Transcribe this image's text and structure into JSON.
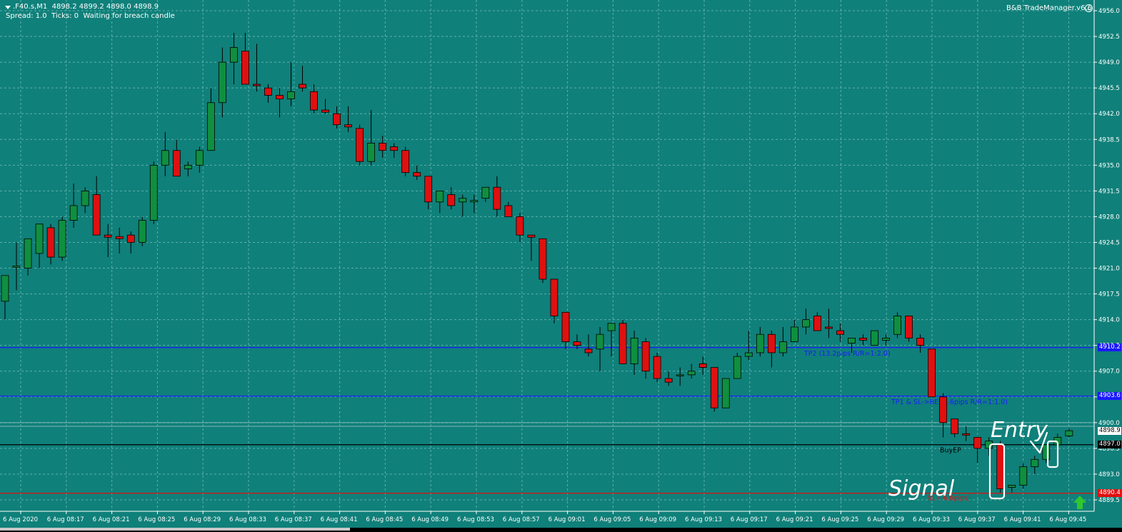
{
  "header": {
    "symbol": ".F40.s,M1",
    "ohlc": "4898.2 4899.2 4898.0 4898.9",
    "status": "Spread: 1.0  Ticks: 0  Waiting for breach candle"
  },
  "trade_manager": {
    "label": "B&B TradeManager.v6.6",
    "icon": "smiley-icon"
  },
  "price_axis": {
    "ticks": [
      "4956.0",
      "4952.5",
      "4949.0",
      "4945.5",
      "4942.0",
      "4938.5",
      "4935.0",
      "4931.5",
      "4928.0",
      "4924.5",
      "4921.0",
      "4917.5",
      "4914.0",
      "4910.5",
      "4907.0",
      "4903.5",
      "4900.0",
      "4896.5",
      "4893.0",
      "4889.5"
    ],
    "range": [
      4888.6,
      4956.0
    ]
  },
  "time_axis": {
    "labels": [
      "6 Aug 2020",
      "6 Aug 08:17",
      "6 Aug 08:21",
      "6 Aug 08:25",
      "6 Aug 08:29",
      "6 Aug 08:33",
      "6 Aug 08:37",
      "6 Aug 08:41",
      "6 Aug 08:45",
      "6 Aug 08:49",
      "6 Aug 08:53",
      "6 Aug 08:57",
      "6 Aug 09:01",
      "6 Aug 09:05",
      "6 Aug 09:09",
      "6 Aug 09:13",
      "6 Aug 09:17",
      "6 Aug 09:21",
      "6 Aug 09:25",
      "6 Aug 09:29",
      "6 Aug 09:33",
      "6 Aug 09:37",
      "6 Aug 09:41",
      "6 Aug 09:45"
    ]
  },
  "levels": [
    {
      "id": "tp2",
      "price": 4910.2,
      "tag": "4910.2",
      "label": "TP2 (13.2pips R/R=1:2.0)",
      "color": "#1a1aff"
    },
    {
      "id": "tp1",
      "price": 4903.6,
      "tag": "4903.6",
      "label": "TP1 & SL->BE (6.6pips R/R=1:1.0)",
      "color": "#1a1aff"
    },
    {
      "id": "buyep",
      "price": 4897.0,
      "tag": "4897.0",
      "label": "BuyEP",
      "color": "#000000"
    },
    {
      "id": "sl",
      "price": 4890.4,
      "tag": "4890.4",
      "label": "SL (-6.6pips)",
      "color": "#e01010"
    }
  ],
  "current_price": {
    "value": 4898.9,
    "tag": "4898.9"
  },
  "annotations": {
    "signal": "Signal",
    "entry": "Entry"
  },
  "colors": {
    "background": "#10807a",
    "bull": "#0f8f3f",
    "bear": "#e01010",
    "grid": "#5fb0ab"
  },
  "chart_data": {
    "type": "candlestick",
    "title": "",
    "xlabel": "",
    "ylabel": "",
    "ylim": [
      4888.6,
      4956.0
    ],
    "grid": true,
    "candles": [
      {
        "o": 4916.5,
        "h": 4919,
        "l": 4914,
        "c": 4920
      },
      {
        "o": 4921.1,
        "h": 4924.5,
        "l": 4918,
        "c": 4921.3
      },
      {
        "o": 4921,
        "h": 4924,
        "l": 4920,
        "c": 4925
      },
      {
        "o": 4923,
        "h": 4927,
        "l": 4921,
        "c": 4927
      },
      {
        "o": 4926.5,
        "h": 4927,
        "l": 4921.5,
        "c": 4922.5
      },
      {
        "o": 4922.5,
        "h": 4928,
        "l": 4922,
        "c": 4927.5
      },
      {
        "o": 4927.5,
        "h": 4932.5,
        "l": 4926.5,
        "c": 4929.5
      },
      {
        "o": 4929.5,
        "h": 4932,
        "l": 4928.5,
        "c": 4931.5
      },
      {
        "o": 4931,
        "h": 4933.5,
        "l": 4925.5,
        "c": 4925.5
      },
      {
        "o": 4925.5,
        "h": 4927,
        "l": 4922.5,
        "c": 4925.2
      },
      {
        "o": 4925.3,
        "h": 4926.5,
        "l": 4923,
        "c": 4925
      },
      {
        "o": 4925.5,
        "h": 4926,
        "l": 4923,
        "c": 4924.5
      },
      {
        "o": 4924.5,
        "h": 4928,
        "l": 4924,
        "c": 4927.5
      },
      {
        "o": 4927.5,
        "h": 4935.5,
        "l": 4927,
        "c": 4935
      },
      {
        "o": 4935,
        "h": 4939.5,
        "l": 4933.5,
        "c": 4937
      },
      {
        "o": 4937,
        "h": 4938.5,
        "l": 4933.5,
        "c": 4933.5
      },
      {
        "o": 4934.5,
        "h": 4935.5,
        "l": 4933.5,
        "c": 4935
      },
      {
        "o": 4935,
        "h": 4937.5,
        "l": 4934,
        "c": 4937
      },
      {
        "o": 4937,
        "h": 4945.5,
        "l": 4937,
        "c": 4943.5
      },
      {
        "o": 4943.5,
        "h": 4951,
        "l": 4941.5,
        "c": 4949
      },
      {
        "o": 4949,
        "h": 4953,
        "l": 4946,
        "c": 4951
      },
      {
        "o": 4950.5,
        "h": 4953,
        "l": 4946,
        "c": 4946
      },
      {
        "o": 4946,
        "h": 4951.5,
        "l": 4945,
        "c": 4945.8
      },
      {
        "o": 4945.5,
        "h": 4946,
        "l": 4943.5,
        "c": 4944.5
      },
      {
        "o": 4944.5,
        "h": 4945.5,
        "l": 4941.5,
        "c": 4944
      },
      {
        "o": 4944,
        "h": 4949,
        "l": 4943,
        "c": 4945
      },
      {
        "o": 4946,
        "h": 4948.5,
        "l": 4945,
        "c": 4945.5
      },
      {
        "o": 4945,
        "h": 4946,
        "l": 4942,
        "c": 4942.5
      },
      {
        "o": 4942.5,
        "h": 4944,
        "l": 4942,
        "c": 4942.2
      },
      {
        "o": 4942,
        "h": 4943,
        "l": 4940,
        "c": 4940.5
      },
      {
        "o": 4940.5,
        "h": 4943,
        "l": 4939.5,
        "c": 4940.2
      },
      {
        "o": 4940,
        "h": 4940.5,
        "l": 4935,
        "c": 4935.5
      },
      {
        "o": 4935.5,
        "h": 4942.5,
        "l": 4935,
        "c": 4938
      },
      {
        "o": 4938,
        "h": 4939,
        "l": 4936,
        "c": 4937
      },
      {
        "o": 4937.5,
        "h": 4938,
        "l": 4936,
        "c": 4937
      },
      {
        "o": 4937,
        "h": 4937.5,
        "l": 4933.5,
        "c": 4934
      },
      {
        "o": 4934,
        "h": 4935,
        "l": 4933,
        "c": 4933.5
      },
      {
        "o": 4933.5,
        "h": 4933.5,
        "l": 4929,
        "c": 4930
      },
      {
        "o": 4930,
        "h": 4931.5,
        "l": 4928.5,
        "c": 4931.5
      },
      {
        "o": 4931,
        "h": 4932,
        "l": 4929,
        "c": 4929.5
      },
      {
        "o": 4930,
        "h": 4931,
        "l": 4928,
        "c": 4930.5
      },
      {
        "o": 4930,
        "h": 4931,
        "l": 4928.5,
        "c": 4930.2
      },
      {
        "o": 4930.5,
        "h": 4932,
        "l": 4930,
        "c": 4932
      },
      {
        "o": 4932,
        "h": 4933.5,
        "l": 4928,
        "c": 4929
      },
      {
        "o": 4929.5,
        "h": 4930,
        "l": 4928,
        "c": 4928
      },
      {
        "o": 4928,
        "h": 4928.5,
        "l": 4924.5,
        "c": 4925.5
      },
      {
        "o": 4925.5,
        "h": 4925.5,
        "l": 4922,
        "c": 4925.2
      },
      {
        "o": 4925,
        "h": 4925,
        "l": 4919,
        "c": 4919.5
      },
      {
        "o": 4919.5,
        "h": 4919.5,
        "l": 4913.5,
        "c": 4914.5
      },
      {
        "o": 4915,
        "h": 4915,
        "l": 4910,
        "c": 4911
      },
      {
        "o": 4911,
        "h": 4912,
        "l": 4910,
        "c": 4910.5
      },
      {
        "o": 4910,
        "h": 4912,
        "l": 4909,
        "c": 4909.5
      },
      {
        "o": 4910,
        "h": 4913,
        "l": 4907,
        "c": 4912
      },
      {
        "o": 4912.5,
        "h": 4913.5,
        "l": 4909,
        "c": 4913.5
      },
      {
        "o": 4913.5,
        "h": 4914,
        "l": 4908,
        "c": 4908
      },
      {
        "o": 4908,
        "h": 4912.5,
        "l": 4906.5,
        "c": 4911.5
      },
      {
        "o": 4911,
        "h": 4911.5,
        "l": 4906,
        "c": 4907
      },
      {
        "o": 4909,
        "h": 4909.5,
        "l": 4905.5,
        "c": 4906
      },
      {
        "o": 4906,
        "h": 4907,
        "l": 4905,
        "c": 4905.5
      },
      {
        "o": 4906.5,
        "h": 4907.5,
        "l": 4905,
        "c": 4906.5
      },
      {
        "o": 4906.5,
        "h": 4908,
        "l": 4906,
        "c": 4907
      },
      {
        "o": 4908,
        "h": 4909,
        "l": 4906.5,
        "c": 4907.5
      },
      {
        "o": 4907.5,
        "h": 4907.5,
        "l": 4901.5,
        "c": 4902
      },
      {
        "o": 4902,
        "h": 4906,
        "l": 4902,
        "c": 4906
      },
      {
        "o": 4906,
        "h": 4909.5,
        "l": 4906,
        "c": 4909
      },
      {
        "o": 4909,
        "h": 4912.5,
        "l": 4908.5,
        "c": 4909.5
      },
      {
        "o": 4909.5,
        "h": 4913,
        "l": 4909,
        "c": 4912
      },
      {
        "o": 4912,
        "h": 4912.5,
        "l": 4907.5,
        "c": 4909.5
      },
      {
        "o": 4909.5,
        "h": 4913,
        "l": 4909,
        "c": 4911
      },
      {
        "o": 4911,
        "h": 4914,
        "l": 4911,
        "c": 4913
      },
      {
        "o": 4913,
        "h": 4915.5,
        "l": 4912,
        "c": 4914
      },
      {
        "o": 4914.5,
        "h": 4915,
        "l": 4912.5,
        "c": 4912.5
      },
      {
        "o": 4913,
        "h": 4915.5,
        "l": 4911.5,
        "c": 4912.8
      },
      {
        "o": 4912.5,
        "h": 4913.5,
        "l": 4911,
        "c": 4912
      },
      {
        "o": 4910.8,
        "h": 4911.5,
        "l": 4909.5,
        "c": 4911.5
      },
      {
        "o": 4911.5,
        "h": 4912,
        "l": 4910.5,
        "c": 4911.2
      },
      {
        "o": 4910.5,
        "h": 4912.5,
        "l": 4910.5,
        "c": 4912.5
      },
      {
        "o": 4911.2,
        "h": 4912,
        "l": 4910.5,
        "c": 4911.5
      },
      {
        "o": 4912,
        "h": 4915,
        "l": 4911.5,
        "c": 4914.5
      },
      {
        "o": 4914.5,
        "h": 4914.5,
        "l": 4911,
        "c": 4911.5
      },
      {
        "o": 4911.5,
        "h": 4912,
        "l": 4909.5,
        "c": 4910.5
      },
      {
        "o": 4910,
        "h": 4910,
        "l": 4903.5,
        "c": 4903.5
      },
      {
        "o": 4903.5,
        "h": 4904,
        "l": 4898,
        "c": 4900
      },
      {
        "o": 4900.5,
        "h": 4900.5,
        "l": 4898,
        "c": 4898.5
      },
      {
        "o": 4898.5,
        "h": 4899.5,
        "l": 4897.5,
        "c": 4898.3
      },
      {
        "o": 4898,
        "h": 4898,
        "l": 4894.5,
        "c": 4896.5
      },
      {
        "o": 4896.5,
        "h": 4898,
        "l": 4895.5,
        "c": 4897.5
      },
      {
        "o": 4897,
        "h": 4897.5,
        "l": 4890.5,
        "c": 4891
      },
      {
        "o": 4891.2,
        "h": 4891.5,
        "l": 4890.5,
        "c": 4891.5
      },
      {
        "o": 4891.5,
        "h": 4894.5,
        "l": 4891,
        "c": 4894
      },
      {
        "o": 4894,
        "h": 4895.5,
        "l": 4893,
        "c": 4895
      },
      {
        "o": 4895,
        "h": 4897,
        "l": 4894.5,
        "c": 4897
      },
      {
        "o": 4897,
        "h": 4898.5,
        "l": 4896.5,
        "c": 4898
      },
      {
        "o": 4898.2,
        "h": 4899.2,
        "l": 4898,
        "c": 4898.9
      }
    ]
  }
}
